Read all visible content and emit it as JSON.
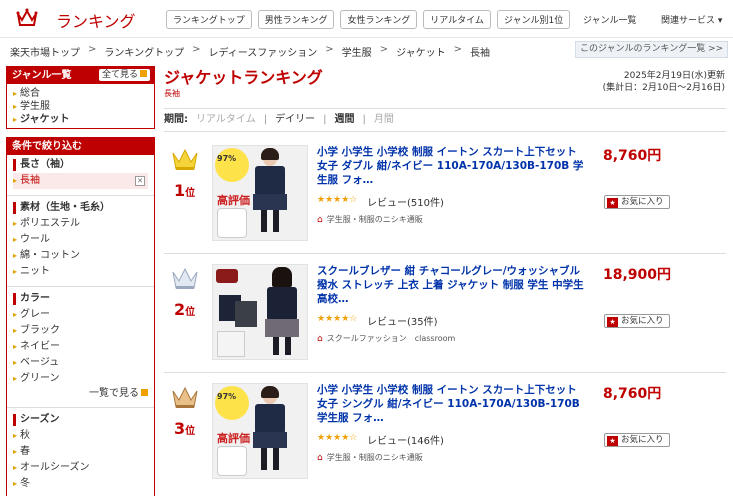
{
  "header": {
    "site_title": "ランキング",
    "tabs": [
      "ランキングトップ",
      "男性ランキング",
      "女性ランキング",
      "リアルタイム",
      "ジャンル別1位"
    ],
    "genre_list": "ジャンル一覧",
    "services": "関連サービス ▾"
  },
  "breadcrumb": [
    "楽天市場トップ",
    "ランキングトップ",
    "レディースファッション",
    "学生服",
    "ジャケット",
    "長袖"
  ],
  "genre_ranking_link": "このジャンルのランキング一覧 >>",
  "sidebar": {
    "genre_head": "ジャンル一覧",
    "see_all": "全て見る",
    "genres": [
      "総合",
      "学生服",
      "ジャケット"
    ],
    "filter_head": "条件で絞り込む",
    "length": {
      "title": "長さ（袖）",
      "selected": "長袖"
    },
    "material": {
      "title": "素材（生地・毛糸）",
      "items": [
        "ポリエステル",
        "ウール",
        "綿・コットン",
        "ニット"
      ]
    },
    "color": {
      "title": "カラー",
      "items": [
        "グレー",
        "ブラック",
        "ネイビー",
        "ベージュ",
        "グリーン"
      ],
      "more": "一覧で見る"
    },
    "season": {
      "title": "シーズン",
      "items": [
        "秋",
        "春",
        "オールシーズン",
        "冬"
      ]
    }
  },
  "main": {
    "title": "ジャケットランキング",
    "sub_genre": "長袖",
    "update": "2025年2月19日(水)更新",
    "period_range": "(集計日：2月10日〜2月16日)",
    "period": {
      "label": "期間:",
      "realtime": "リアルタイム",
      "daily": "デイリー",
      "weekly": "週間",
      "monthly": "月間"
    }
  },
  "items": [
    {
      "rank": "1",
      "rank_suffix": "位",
      "title": "小学 小学生 小学校 制服 イートン スカート上下セット 女子 ダブル 紺/ネイビー 110A-170A/130B-170B 学生服 フォ…",
      "price": "8,760円",
      "stars": "★★★★☆",
      "review": "レビュー(510件)",
      "shop": "学生服・制服のニシキ通販",
      "fav": "お気に入り",
      "badge_pct": "97%",
      "badge_word": "高評価"
    },
    {
      "rank": "2",
      "rank_suffix": "位",
      "title": "スクールブレザー 紺 チャコールグレー/ウォッシャブル 撥水 ストレッチ 上衣 上着 ジャケット 制服 学生 中学生 高校…",
      "price": "18,900円",
      "stars": "★★★★☆",
      "review": "レビュー(35件)",
      "shop": "スクールファッション　classroom",
      "fav": "お気に入り",
      "badge_pct": "",
      "badge_word": ""
    },
    {
      "rank": "3",
      "rank_suffix": "位",
      "title": "小学 小学生 小学校 制服 イートン スカート上下セット 女子 シングル 紺/ネイビー 110A-170A/130B-170B 学生服 フォ…",
      "price": "8,760円",
      "stars": "★★★★☆",
      "review": "レビュー(146件)",
      "shop": "学生服・制服のニシキ通販",
      "fav": "お気に入り",
      "badge_pct": "97%",
      "badge_word": "高評価"
    }
  ],
  "colors": {
    "brand_red": "#bf0000",
    "link_blue": "#0033aa",
    "gold": "#e8b800",
    "silver": "#b8c4d6",
    "bronze": "#c59b5a"
  },
  "icons": {
    "logo": "crown-icon",
    "fav": "star-icon",
    "shop": "home-icon"
  }
}
